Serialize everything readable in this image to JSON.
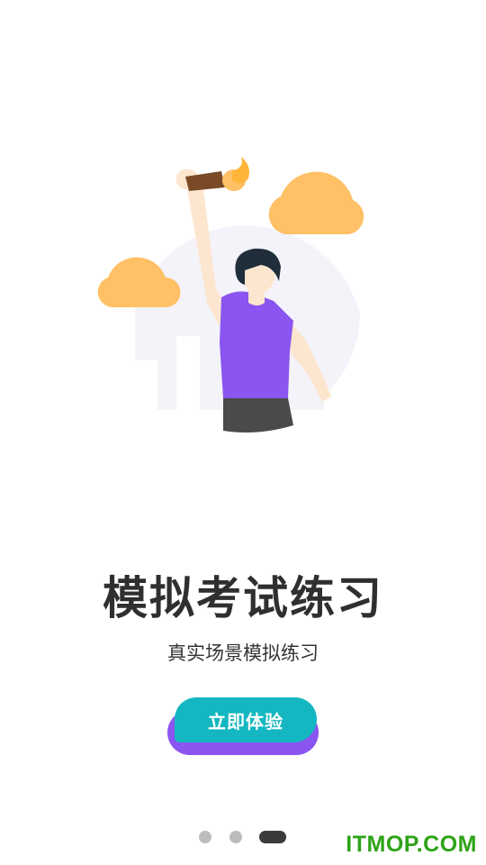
{
  "onboarding": {
    "illustration": {
      "icon": "person-raising-torch-illustration",
      "colors": {
        "cloud": "#ffc066",
        "circle": "#f4f3f9",
        "shirt": "#8a55f0",
        "shorts": "#4a4a4a",
        "skin": "#fde6cf",
        "hair": "#1f2e3a",
        "torch": "#7a4a26",
        "flame": "#ffb43a"
      }
    },
    "title": "模拟考试练习",
    "subtitle": "真实场景模拟练习",
    "cta_label": "立即体验",
    "pagination": {
      "total": 3,
      "active": 3
    },
    "watermark": "ITMOP.COM",
    "colors": {
      "button": "#14b7c1",
      "button_shadow": "#8a55f0",
      "dot_inactive": "#bdbdbd",
      "dot_active": "#3b3b3b",
      "watermark": "#2ea318"
    }
  }
}
